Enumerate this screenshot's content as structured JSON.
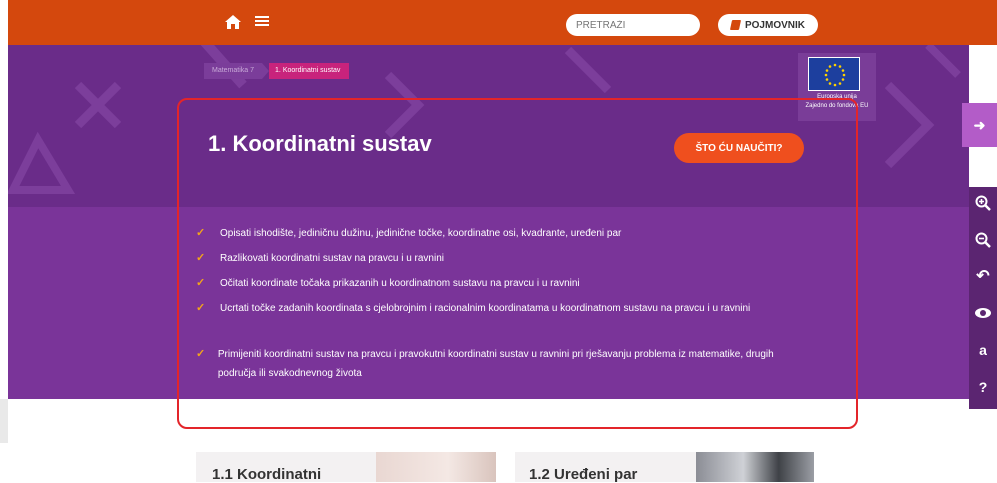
{
  "nav": {
    "search_placeholder": "PRETRAŽI",
    "glossary_label": "POJMOVNIK",
    "brand_color": "#d4480d"
  },
  "breadcrumb": {
    "parent": "Matematika 7",
    "current": "1. Koordinatni sustav"
  },
  "hero": {
    "title": "1. Koordinatni sustav",
    "learn_button": "ŠTO ĆU NAUČITI?",
    "eu_line1": "Europska unija",
    "eu_line2": "Zajedno do fondova EU",
    "accent_color": "#ef4f1e",
    "background_color": "#6a2c89"
  },
  "outcomes": [
    "Opisati ishodište, jediničnu dužinu, jedinične točke, koordinatne osi, kvadrante, uređeni par",
    "Razlikovati koordinatni sustav na pravcu i u ravnini",
    "Očitati koordinate točaka prikazanih u koordinatnom sustavu na pravcu i u ravnini",
    "Ucrtati točke zadanih koordinata s cjelobrojnim i racionalnim koordinatama u koordinatnom sustavu na pravcu i u ravnini",
    "Primijeniti koordinatni sustav na pravcu i pravokutni koordinatni sustav u ravnini pri rješavanju problema iz matematike, drugih područja ili svakodnevnog života"
  ],
  "tools": {
    "zoom_in": "zoom-in-icon",
    "zoom_out": "zoom-out-icon",
    "reset": "undo-icon",
    "contrast": "eye-icon",
    "font": "a",
    "help": "?"
  },
  "cards": [
    {
      "title": "1.1 Koordinatni"
    },
    {
      "title": "1.2 Uređeni par"
    }
  ],
  "highlight_color": "#e3252a"
}
